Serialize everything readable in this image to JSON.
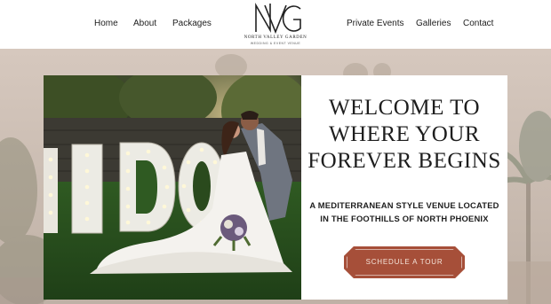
{
  "nav": {
    "left": [
      {
        "label": "Home"
      },
      {
        "label": "About"
      },
      {
        "label": "Packages"
      }
    ],
    "right": [
      {
        "label": "Private Events"
      },
      {
        "label": "Galleries"
      },
      {
        "label": "Contact"
      }
    ]
  },
  "logo": {
    "monogram": "NVG",
    "name": "NORTH VALLEY GARDEN",
    "subtitle": "WEDDING & EVENT VENUE"
  },
  "hero": {
    "headline_lines": [
      "WELCOME TO",
      "WHERE YOUR",
      "FOREVER BEGINS"
    ],
    "tagline_lines": [
      "A MEDITERRANEAN STYLE VENUE LOCATED",
      "IN THE FOOTHILLS OF NORTH PHOENIX"
    ],
    "cta_label": "SCHEDULE A TOUR",
    "photo_sign_letters": "IDO"
  },
  "colors": {
    "cta": "#a64f39",
    "background": "#cbbdb3",
    "header": "#ffffff"
  }
}
